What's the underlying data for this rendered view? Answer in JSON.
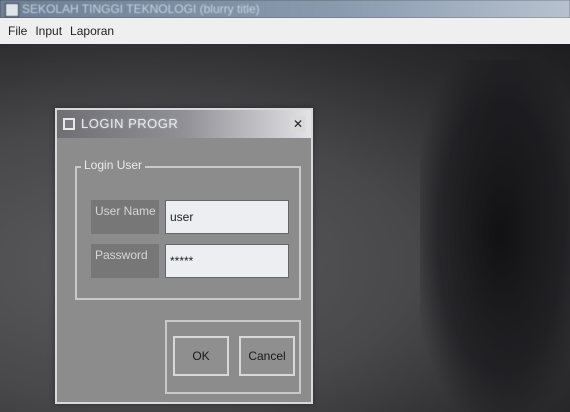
{
  "window": {
    "title": "SEKOLAH TINGGI TEKNOLOGI (blurry title)"
  },
  "menubar": {
    "items": [
      "File",
      "Input",
      "Laporan"
    ]
  },
  "dialog": {
    "title": "LOGIN PROGR",
    "group_label": "Login User",
    "username": {
      "label": "User Name",
      "value": "user"
    },
    "password": {
      "label": "Password",
      "value": "*****"
    },
    "buttons": {
      "ok": "OK",
      "cancel": "Cancel"
    }
  }
}
